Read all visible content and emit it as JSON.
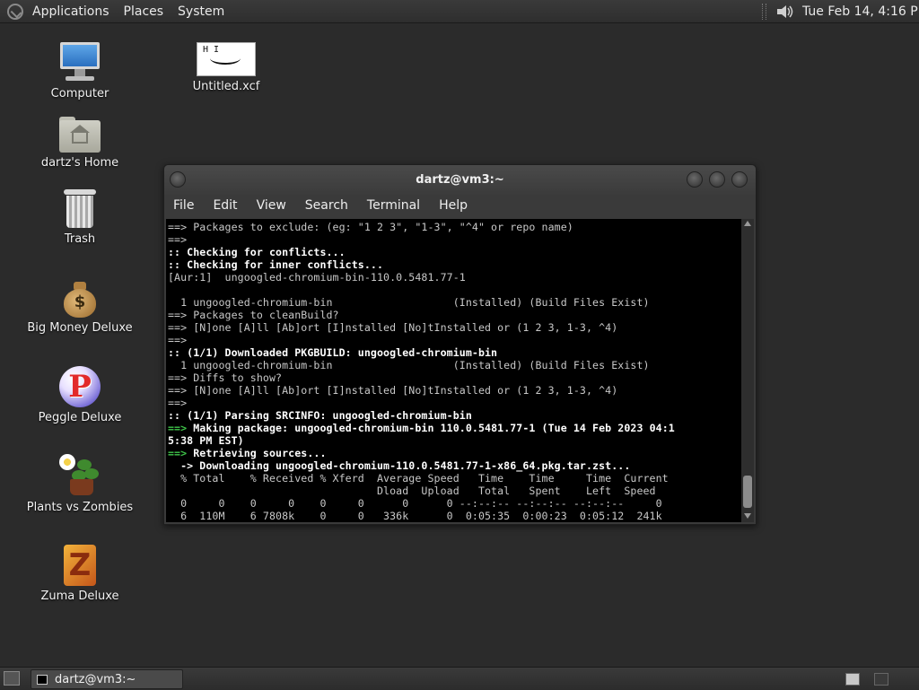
{
  "top_panel": {
    "menus": [
      "Applications",
      "Places",
      "System"
    ],
    "clock": "Tue Feb 14, 4:16 PM"
  },
  "desktop": {
    "icons": [
      {
        "label": "Computer",
        "icon": "computer-icon"
      },
      {
        "label": "dartz's Home",
        "icon": "home-folder-icon"
      },
      {
        "label": "Trash",
        "icon": "trash-icon"
      },
      {
        "label": "Big Money Deluxe",
        "icon": "money-bag-icon"
      },
      {
        "label": "Peggle Deluxe",
        "icon": "peggle-icon"
      },
      {
        "label": "Plants vs Zombies",
        "icon": "plants-vs-zombies-icon"
      },
      {
        "label": "Zuma Deluxe",
        "icon": "zuma-icon"
      },
      {
        "label": "Untitled.xcf",
        "icon": "image-thumbnail-icon",
        "thumb_text": "H I"
      }
    ]
  },
  "terminal": {
    "title": "dartz@vm3:~",
    "menus": [
      "File",
      "Edit",
      "View",
      "Search",
      "Terminal",
      "Help"
    ],
    "lines": [
      {
        "s": "pl",
        "t": "==> Packages to exclude: (eg: \"1 2 3\", \"1-3\", \"^4\" or repo name)"
      },
      {
        "s": "pl",
        "t": "==>"
      },
      {
        "s": "b",
        "t": ":: Checking for conflicts..."
      },
      {
        "s": "b",
        "t": ":: Checking for inner conflicts..."
      },
      {
        "s": "pl",
        "t": "[Aur:1]  ungoogled-chromium-bin-110.0.5481.77-1"
      },
      {
        "s": "pl",
        "t": ""
      },
      {
        "s": "pl",
        "t": "  1 ungoogled-chromium-bin                   (Installed) (Build Files Exist)"
      },
      {
        "s": "pl",
        "t": "==> Packages to cleanBuild?"
      },
      {
        "s": "pl",
        "t": "==> [N]one [A]ll [Ab]ort [I]nstalled [No]tInstalled or (1 2 3, 1-3, ^4)"
      },
      {
        "s": "pl",
        "t": "==>"
      },
      {
        "s": "b",
        "t": ":: (1/1) Downloaded PKGBUILD: ungoogled-chromium-bin"
      },
      {
        "s": "pl",
        "t": "  1 ungoogled-chromium-bin                   (Installed) (Build Files Exist)"
      },
      {
        "s": "pl",
        "t": "==> Diffs to show?"
      },
      {
        "s": "pl",
        "t": "==> [N]one [A]ll [Ab]ort [I]nstalled [No]tInstalled or (1 2 3, 1-3, ^4)"
      },
      {
        "s": "pl",
        "t": "==>"
      },
      {
        "s": "b",
        "t": ":: (1/1) Parsing SRCINFO: ungoogled-chromium-bin"
      },
      {
        "s": "g",
        "p": "==>",
        "t": " Making package: ungoogled-chromium-bin 110.0.5481.77-1 (Tue 14 Feb 2023 04:1"
      },
      {
        "s": "b",
        "t": "5:38 PM EST)"
      },
      {
        "s": "g",
        "p": "==>",
        "t": " Retrieving sources..."
      },
      {
        "s": "b",
        "t": "  -> Downloading ungoogled-chromium-110.0.5481.77-1-x86_64.pkg.tar.zst..."
      },
      {
        "s": "pl",
        "t": "  % Total    % Received % Xferd  Average Speed   Time    Time     Time  Current"
      },
      {
        "s": "pl",
        "t": "                                 Dload  Upload   Total   Spent    Left  Speed"
      },
      {
        "s": "pl",
        "t": "  0     0    0     0    0     0      0      0 --:--:-- --:--:-- --:--:--     0"
      },
      {
        "s": "pl",
        "t": "  6  110M    6 7808k    0     0   336k      0  0:05:35  0:00:23  0:05:12  241k"
      }
    ]
  },
  "bottom_panel": {
    "task_label": "dartz@vm3:~"
  }
}
